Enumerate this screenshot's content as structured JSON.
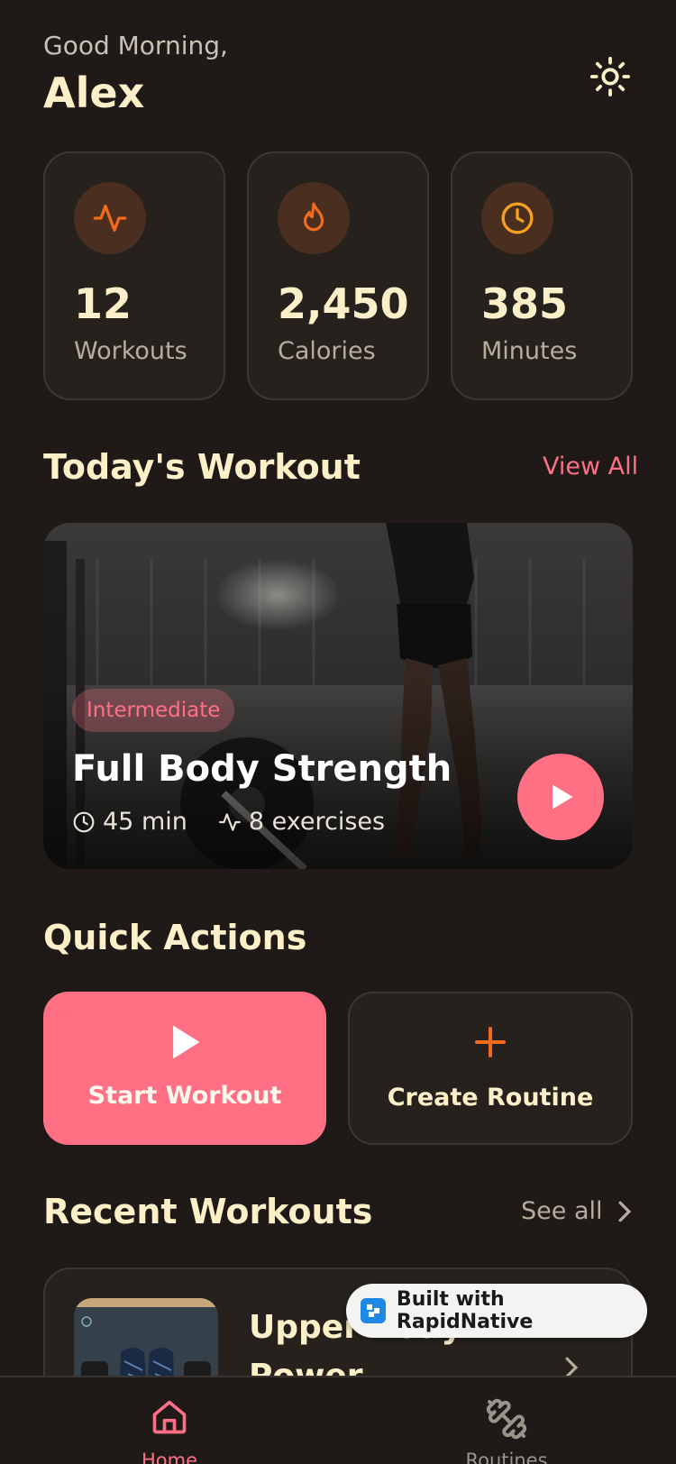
{
  "header": {
    "greeting": "Good Morning,",
    "username": "Alex",
    "theme_toggle_icon": "sun-icon"
  },
  "stats": [
    {
      "icon": "activity-icon",
      "value": "12",
      "label": "Workouts"
    },
    {
      "icon": "flame-icon",
      "value": "2,450",
      "label": "Calories"
    },
    {
      "icon": "clock-icon",
      "value": "385",
      "label": "Minutes"
    }
  ],
  "today": {
    "title": "Today's Workout",
    "view_all": "View All",
    "workout": {
      "level": "Intermediate",
      "name": "Full Body Strength",
      "duration": "45 min",
      "exercises": "8 exercises"
    }
  },
  "quick_actions": {
    "title": "Quick Actions",
    "start": "Start Workout",
    "create": "Create Routine"
  },
  "recent": {
    "title": "Recent Workouts",
    "see_all": "See all",
    "items": [
      {
        "name": "Upper Body Power"
      }
    ]
  },
  "built_with": "Built with RapidNative",
  "tabs": [
    {
      "label": "Home",
      "icon": "home-icon",
      "active": true
    },
    {
      "label": "Routines",
      "icon": "dumbbell-icon",
      "active": false
    }
  ],
  "colors": {
    "background": "#1f1a17",
    "card": "#26211d",
    "accent_pink": "#ff7085",
    "accent_orange": "#f26a1b",
    "text_cream": "#fdf0c8"
  }
}
